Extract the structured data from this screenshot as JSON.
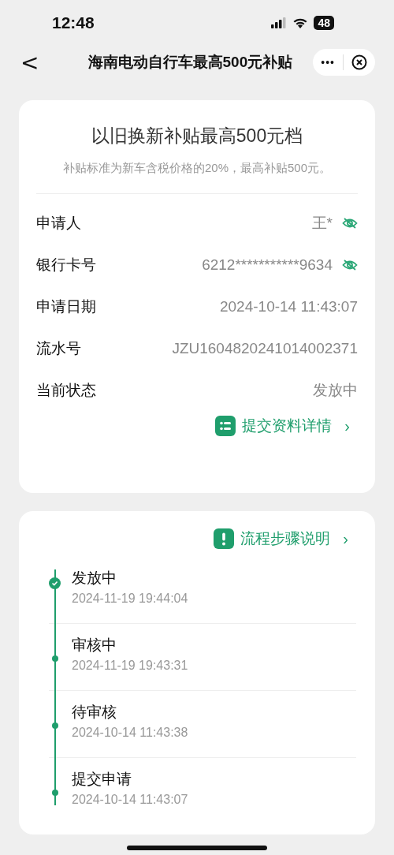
{
  "status_bar": {
    "time": "12:48",
    "battery": "48"
  },
  "nav": {
    "back": "<",
    "title": "海南电动自行车最高500元补贴",
    "more": "•••"
  },
  "summary": {
    "title": "以旧换新补贴最高500元档",
    "note": "补贴标准为新车含税价格的20%，最高补贴500元。"
  },
  "fields": [
    {
      "label": "申请人",
      "value": "王*",
      "kind": "masked"
    },
    {
      "label": "银行卡号",
      "value": "6212***********9634",
      "kind": "masked"
    },
    {
      "label": "申请日期",
      "value": "2024-10-14 11:43:07",
      "kind": "plain"
    },
    {
      "label": "流水号",
      "value": "JZU1604820241014002371",
      "kind": "plain"
    },
    {
      "label": "当前状态",
      "value": "发放中",
      "kind": "plain"
    }
  ],
  "details_link": {
    "label": "提交资料详情",
    "chevron": "›"
  },
  "process_link": {
    "label": "流程步骤说明",
    "chevron": "›"
  },
  "steps": [
    {
      "name": "发放中",
      "time": "2024-11-19 19:44:04",
      "current": true
    },
    {
      "name": "审核中",
      "time": "2024-11-19 19:43:31",
      "current": false
    },
    {
      "name": "待审核",
      "time": "2024-10-14 11:43:38",
      "current": false
    },
    {
      "name": "提交申请",
      "time": "2024-10-14 11:43:07",
      "current": false
    }
  ]
}
